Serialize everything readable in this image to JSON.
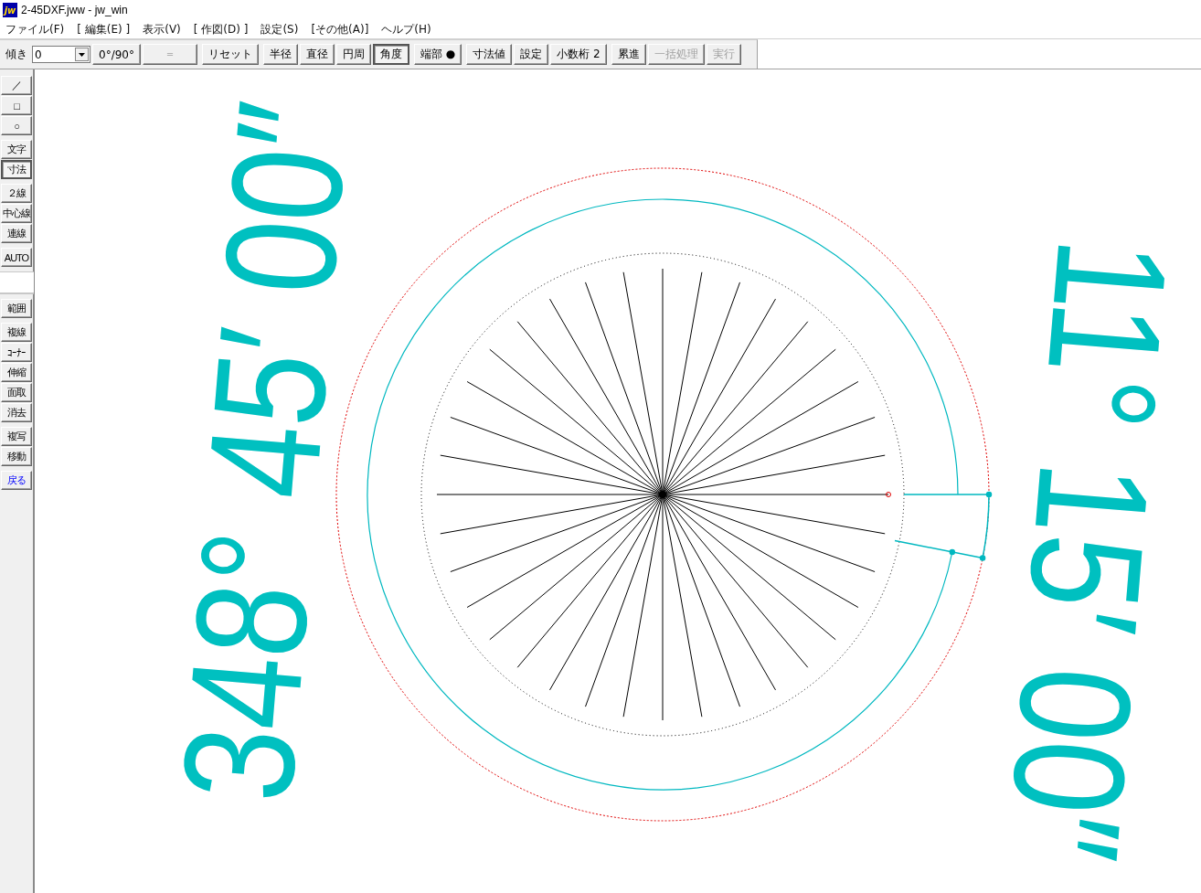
{
  "window": {
    "logo_text": "jw",
    "title": "2-45DXF.jww - jw_win"
  },
  "menu": [
    "ファイル(F)",
    "[ 編集(E) ]",
    "表示(V)",
    "[ 作図(D) ]",
    "設定(S)",
    "[その他(A)]",
    "ヘルプ(H)"
  ],
  "toolbar": {
    "groups": [
      [
        {
          "kind": "label",
          "text": "傾き"
        },
        {
          "kind": "combo",
          "value": "0"
        },
        {
          "kind": "button",
          "text": "0°/90°",
          "selected": false,
          "disabled": false
        },
        {
          "kind": "button",
          "text": "＝",
          "selected": false,
          "disabled": true
        }
      ],
      [
        {
          "kind": "button",
          "text": "リセット",
          "selected": false,
          "disabled": false
        }
      ],
      [
        {
          "kind": "button",
          "text": "半径",
          "selected": false,
          "disabled": false
        },
        {
          "kind": "button",
          "text": "直径",
          "selected": false,
          "disabled": false
        },
        {
          "kind": "button",
          "text": "円周",
          "selected": false,
          "disabled": false
        },
        {
          "kind": "button",
          "text": "角度",
          "selected": true,
          "disabled": false
        }
      ],
      [
        {
          "kind": "button",
          "text": "端部 ●",
          "selected": false,
          "disabled": false
        }
      ],
      [
        {
          "kind": "button",
          "text": "寸法値",
          "selected": false,
          "disabled": false
        },
        {
          "kind": "button",
          "text": "設定",
          "selected": false,
          "disabled": false
        },
        {
          "kind": "button",
          "text": "小数桁 2",
          "selected": false,
          "disabled": false
        }
      ],
      [
        {
          "kind": "button",
          "text": "累進",
          "selected": false,
          "disabled": false
        },
        {
          "kind": "button",
          "text": "一括処理",
          "selected": false,
          "disabled": true
        },
        {
          "kind": "button",
          "text": "実行",
          "selected": false,
          "disabled": true
        }
      ]
    ]
  },
  "sidebar": {
    "groups": [
      [
        {
          "text": "／",
          "selected": false
        },
        {
          "text": "□",
          "selected": false
        },
        {
          "text": "○",
          "selected": false
        }
      ],
      [
        {
          "text": "文字",
          "selected": false
        },
        {
          "text": "寸法",
          "selected": true
        }
      ],
      [
        {
          "text": "２線",
          "selected": false
        },
        {
          "text": "中心線",
          "selected": false
        },
        {
          "text": "連線",
          "selected": false
        }
      ],
      [
        {
          "text": "AUTO",
          "selected": false
        }
      ],
      [
        {
          "kind": "separator"
        }
      ],
      [
        {
          "text": "範囲",
          "selected": false
        }
      ],
      [
        {
          "text": "複線",
          "selected": false
        },
        {
          "text": "ｺｰﾅｰ",
          "selected": false
        },
        {
          "text": "伸縮",
          "selected": false
        },
        {
          "text": "面取",
          "selected": false
        },
        {
          "text": "消去",
          "selected": false
        }
      ],
      [
        {
          "text": "複写",
          "selected": false
        },
        {
          "text": "移動",
          "selected": false
        }
      ],
      [
        {
          "text": "戻る",
          "selected": false,
          "kind": "back"
        }
      ]
    ]
  },
  "drawing": {
    "angle_labels": [
      {
        "text": "348° 45′ 00″"
      },
      {
        "text": "11° 15′ 00″"
      }
    ]
  }
}
